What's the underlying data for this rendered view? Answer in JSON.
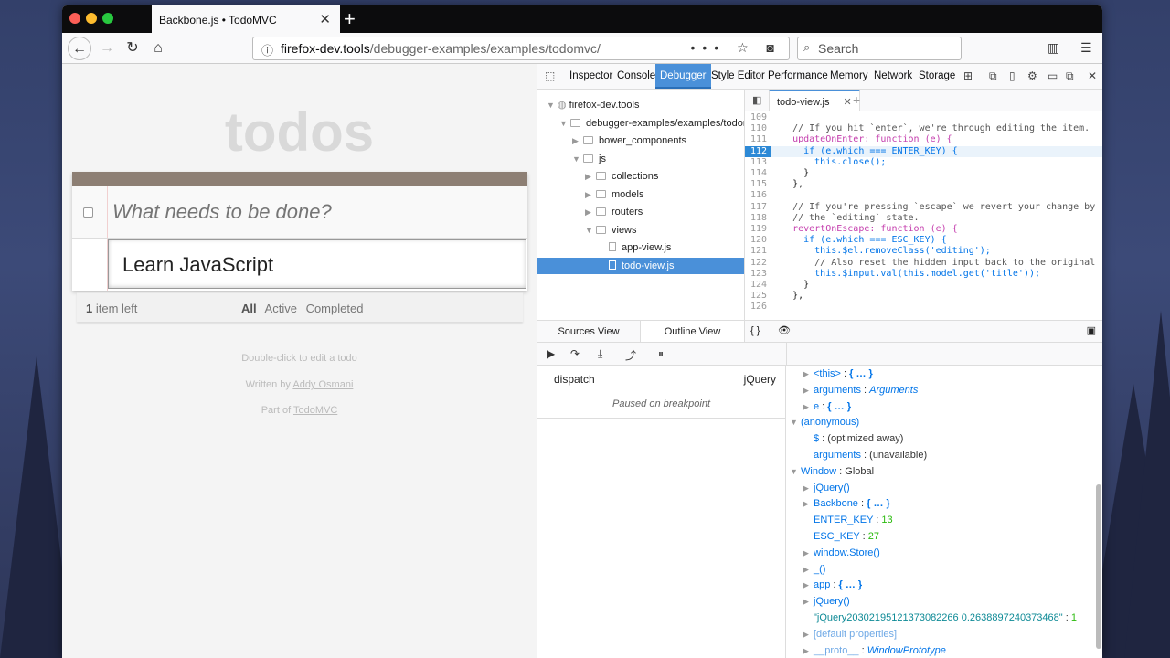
{
  "browser": {
    "tab_title": "Backbone.js • TodoMVC",
    "url_host": "firefox-dev.tools",
    "url_path": "/debugger-examples/examples/todomvc/",
    "search_placeholder": "Search",
    "url_icons": "••• ☆ ◙"
  },
  "todo": {
    "title": "todos",
    "new_placeholder": "What needs to be done?",
    "editing_text": "Learn JavaScript",
    "count_num": "1",
    "count_label": " item left",
    "filters": [
      "All",
      "Active",
      "Completed"
    ],
    "info_edit": "Double-click to edit a todo",
    "info_written": "Written by ",
    "info_author": "Addy Osmani",
    "info_part": "Part of ",
    "info_todomvc": "TodoMVC"
  },
  "devtools": {
    "tabs": [
      "Inspector",
      "Console",
      "Debugger",
      "Style Editor",
      "Performance",
      "Memory",
      "Network",
      "Storage"
    ],
    "active_tab": "Debugger",
    "tree": [
      {
        "label": "firefox-dev.tools",
        "kind": "globe",
        "indent": 0,
        "twisty": "▼"
      },
      {
        "label": "debugger-examples/examples/todomvc",
        "kind": "folder",
        "indent": 1,
        "twisty": "▼"
      },
      {
        "label": "bower_components",
        "kind": "folder",
        "indent": 2,
        "twisty": "▶"
      },
      {
        "label": "js",
        "kind": "folder",
        "indent": 2,
        "twisty": "▼"
      },
      {
        "label": "collections",
        "kind": "folder",
        "indent": 3,
        "twisty": "▶"
      },
      {
        "label": "models",
        "kind": "folder",
        "indent": 3,
        "twisty": "▶"
      },
      {
        "label": "routers",
        "kind": "folder",
        "indent": 3,
        "twisty": "▶"
      },
      {
        "label": "views",
        "kind": "folder",
        "indent": 3,
        "twisty": "▼"
      },
      {
        "label": "app-view.js",
        "kind": "file",
        "indent": 4,
        "twisty": ""
      },
      {
        "label": "todo-view.js",
        "kind": "file",
        "indent": 4,
        "twisty": "",
        "selected": true
      }
    ],
    "left_tabs": [
      "Sources View",
      "Outline View"
    ],
    "editor_tab": "todo-view.js",
    "code": [
      {
        "n": "109",
        "t": ""
      },
      {
        "n": "110",
        "t": "    // If you hit `enter`, we're through editing the item.",
        "c": "c-com"
      },
      {
        "n": "111",
        "t": "    updateOnEnter: function (e) {",
        "c": "c-prop"
      },
      {
        "n": "112",
        "t": "      if (e.which === ENTER_KEY) {",
        "c": "c-kw",
        "bp": true
      },
      {
        "n": "113",
        "t": "        this.close();",
        "c": "c-kw"
      },
      {
        "n": "114",
        "t": "      }",
        "c": "c-plain"
      },
      {
        "n": "115",
        "t": "    },",
        "c": "c-plain"
      },
      {
        "n": "116",
        "t": ""
      },
      {
        "n": "117",
        "t": "    // If you're pressing `escape` we revert your change by",
        "c": "c-com"
      },
      {
        "n": "118",
        "t": "    // the `editing` state.",
        "c": "c-com"
      },
      {
        "n": "119",
        "t": "    revertOnEscape: function (e) {",
        "c": "c-prop"
      },
      {
        "n": "120",
        "t": "      if (e.which === ESC_KEY) {",
        "c": "c-kw"
      },
      {
        "n": "121",
        "t": "        this.$el.removeClass('editing');",
        "c": "c-kw"
      },
      {
        "n": "122",
        "t": "        // Also reset the hidden input back to the original",
        "c": "c-com"
      },
      {
        "n": "123",
        "t": "        this.$input.val(this.model.get('title'));",
        "c": "c-kw"
      },
      {
        "n": "124",
        "t": "      }",
        "c": "c-plain"
      },
      {
        "n": "125",
        "t": "    },",
        "c": "c-plain"
      },
      {
        "n": "126",
        "t": ""
      }
    ],
    "editor_footer_left": "{ }",
    "frames": {
      "name": "dispatch",
      "lib": "jQuery",
      "status": "Paused on breakpoint"
    },
    "scopes": [
      {
        "indent": 1,
        "tw": "▶",
        "key": "<this>",
        "sep": " : ",
        "val": "{ … }",
        "vc": "sv-obj"
      },
      {
        "indent": 1,
        "tw": "▶",
        "key": "arguments",
        "sep": " : ",
        "val": "Arguments",
        "vc": "sv-it"
      },
      {
        "indent": 1,
        "tw": "▶",
        "key": "e",
        "sep": " : ",
        "val": "{ … }",
        "vc": "sv-obj"
      },
      {
        "indent": 0,
        "tw": "▼",
        "key": "(anonymous)",
        "sep": "",
        "val": "",
        "vc": "sv-plain"
      },
      {
        "indent": 1,
        "tw": "",
        "key": "$",
        "sep": " : ",
        "val": "(optimized away)",
        "vc": "sv-plain"
      },
      {
        "indent": 1,
        "tw": "",
        "key": "arguments",
        "sep": " : ",
        "val": "(unavailable)",
        "vc": "sv-plain"
      },
      {
        "indent": 0,
        "tw": "▼",
        "key": "Window",
        "sep": " : ",
        "val": "Global",
        "vc": "sv-plain"
      },
      {
        "indent": 1,
        "tw": "▶",
        "key": "jQuery()",
        "sep": "",
        "val": "",
        "vc": "sv-plain"
      },
      {
        "indent": 1,
        "tw": "▶",
        "key": "Backbone",
        "sep": " : ",
        "val": "{ … }",
        "vc": "sv-obj"
      },
      {
        "indent": 1,
        "tw": "",
        "key": "ENTER_KEY",
        "sep": " : ",
        "val": "13",
        "vc": "sv-num"
      },
      {
        "indent": 1,
        "tw": "",
        "key": "ESC_KEY",
        "sep": " : ",
        "val": "27",
        "vc": "sv-num"
      },
      {
        "indent": 1,
        "tw": "▶",
        "key": "window.Store()",
        "sep": "",
        "val": "",
        "vc": "sv-plain"
      },
      {
        "indent": 1,
        "tw": "▶",
        "key": "_()",
        "sep": "",
        "val": "",
        "vc": "sv-plain"
      },
      {
        "indent": 1,
        "tw": "▶",
        "key": "app",
        "sep": " : ",
        "val": "{ … }",
        "vc": "sv-obj"
      },
      {
        "indent": 1,
        "tw": "▶",
        "key": "jQuery()",
        "sep": "",
        "val": "",
        "vc": "sv-plain"
      },
      {
        "indent": 1,
        "tw": "",
        "key": "\"jQuery20302195121373082266 0.2638897240373468\"",
        "sep": " : ",
        "val": "1",
        "vc": "sv-num",
        "keyclass": "sv-str"
      },
      {
        "indent": 1,
        "tw": "▶",
        "key": "[default properties]",
        "sep": "",
        "val": "",
        "vc": "sv-plain",
        "keyclass": "sv-dim"
      },
      {
        "indent": 1,
        "tw": "▶",
        "key": "__proto__",
        "sep": " : ",
        "val": "WindowPrototype",
        "vc": "sv-it",
        "keyclass": "sv-dim"
      }
    ]
  }
}
